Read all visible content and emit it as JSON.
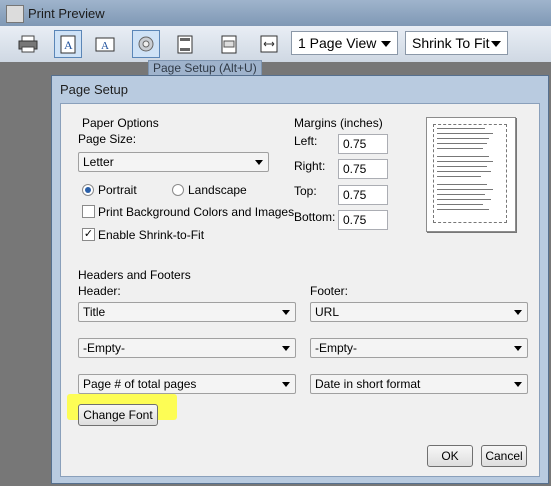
{
  "window": {
    "title": "Print Preview"
  },
  "toolbar": {
    "page_view": "1 Page View",
    "shrink": "Shrink To Fit",
    "tooltip": "Page Setup (Alt+U)",
    "icons": [
      "print-icon",
      "landscape-icon",
      "portrait-icon",
      "page-setup-icon",
      "header-footer-icon",
      "show-full-page-icon",
      "fit-width-icon"
    ]
  },
  "dialog": {
    "title": "Page Setup",
    "paper_options": "Paper Options",
    "page_size_label": "Page Size:",
    "page_size": "Letter",
    "portrait": "Portrait",
    "landscape": "Landscape",
    "print_bg": "Print Background Colors and Images",
    "enable_shrink": "Enable Shrink-to-Fit",
    "margins_label": "Margins (inches)",
    "left_label": "Left:",
    "right_label": "Right:",
    "top_label": "Top:",
    "bottom_label": "Bottom:",
    "left": "0.75",
    "right": "0.75",
    "top": "0.75",
    "bottom": "0.75",
    "headers_footers": "Headers and Footers",
    "header_label": "Header:",
    "footer_label": "Footer:",
    "header1": "Title",
    "header2": "-Empty-",
    "header3": "Page # of total pages",
    "footer1": "URL",
    "footer2": "-Empty-",
    "footer3": "Date in short format",
    "change_font": "Change Font",
    "ok": "OK",
    "cancel": "Cancel"
  }
}
